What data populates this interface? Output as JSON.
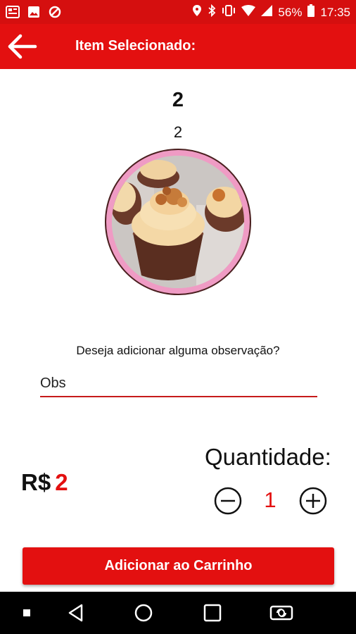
{
  "status_bar": {
    "battery": "56%",
    "time": "17:35"
  },
  "app_bar": {
    "title": "Item Selecionado:"
  },
  "item": {
    "name": "2",
    "description": "2"
  },
  "observation": {
    "question": "Deseja adicionar alguma observação?",
    "placeholder": "Obs"
  },
  "price": {
    "currency": "R$",
    "value": "2"
  },
  "quantity": {
    "label": "Quantidade:",
    "value": "1"
  },
  "cart_button": {
    "label": "Adicionar ao Carrinho"
  },
  "colors": {
    "primary": "#e31010",
    "status_bar": "#d50f0f",
    "ring": "#ef9bc4"
  }
}
